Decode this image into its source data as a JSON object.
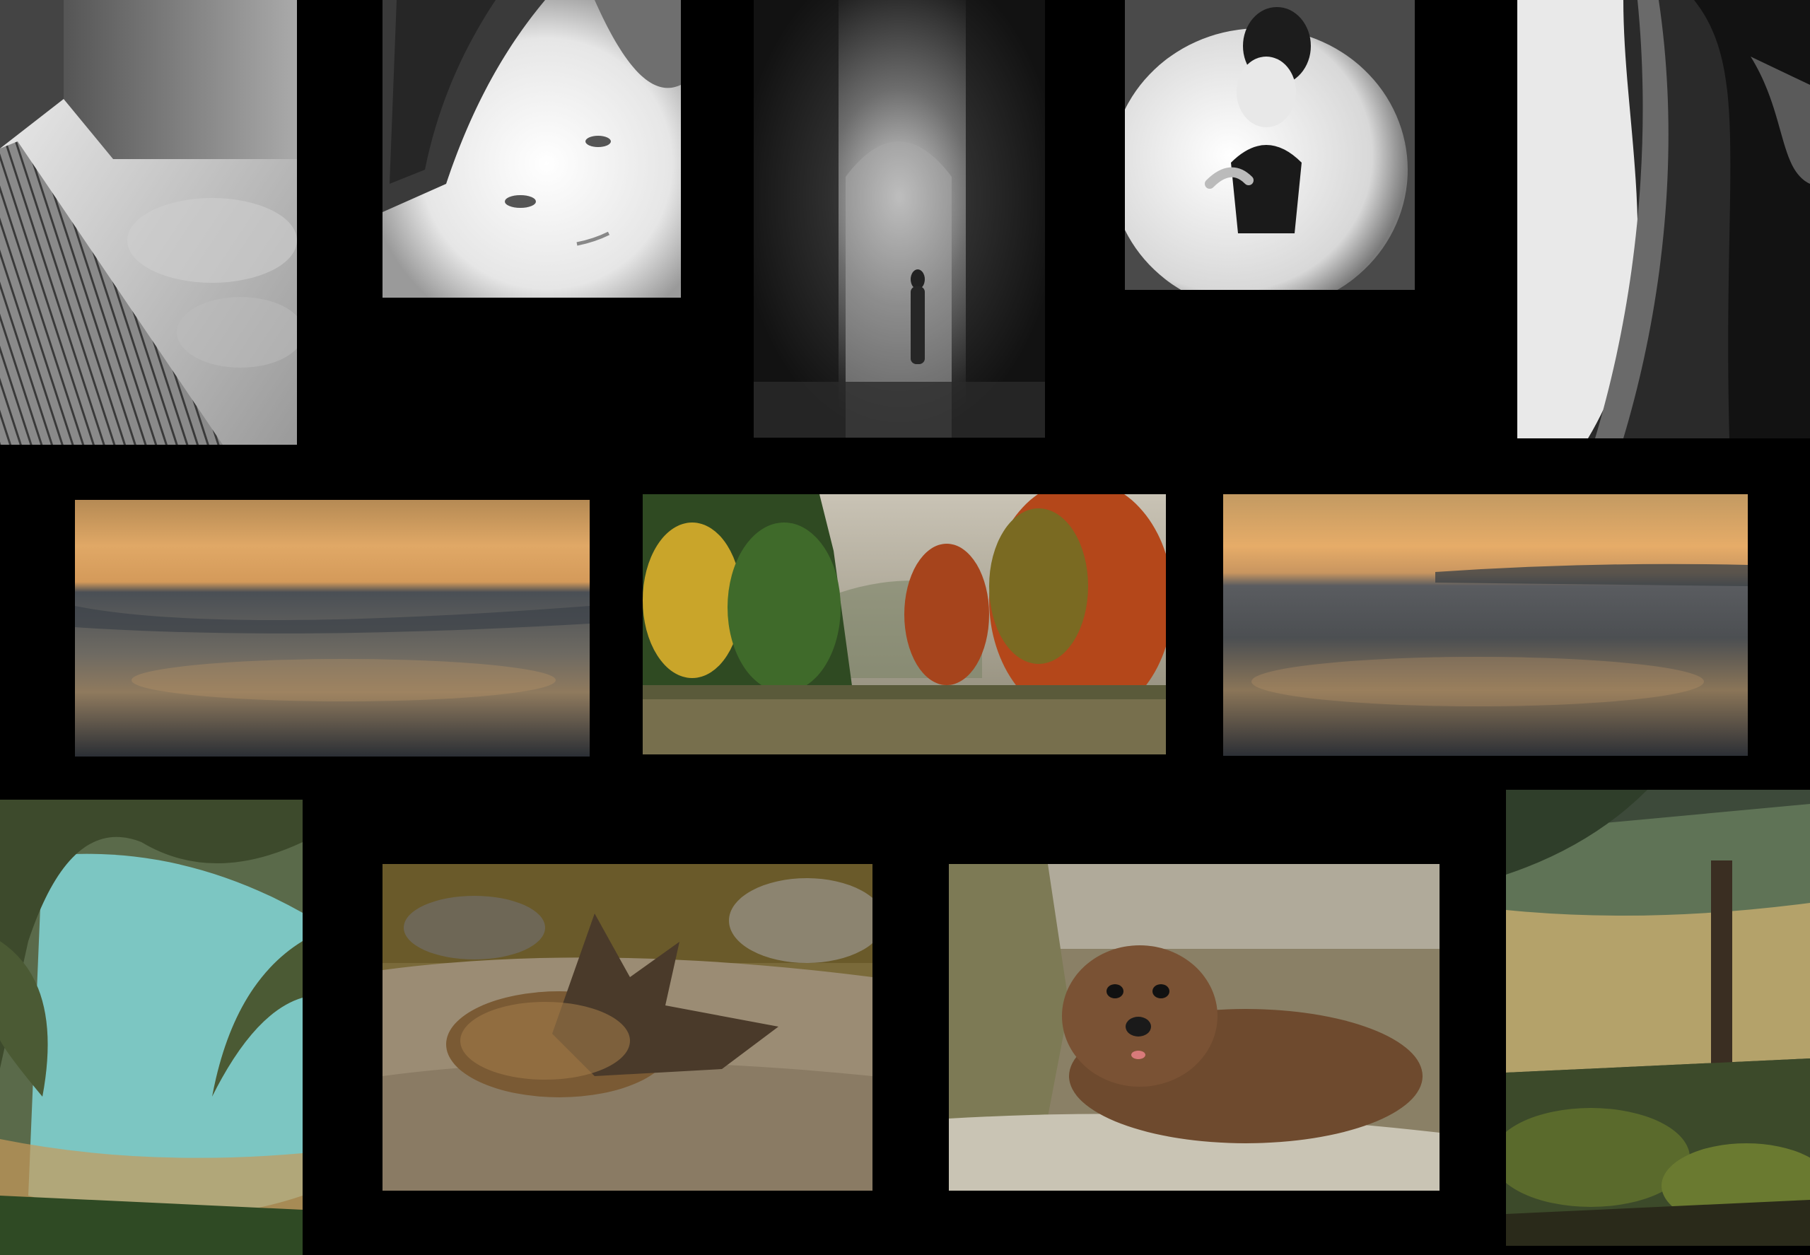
{
  "page": {
    "background": "#000000"
  },
  "gallery": {
    "photos": [
      {
        "name": "architecture-skyward-photo",
        "subject": "architecture",
        "tone": "monochrome"
      },
      {
        "name": "portrait-woman-looking-up-photo",
        "subject": "portrait",
        "tone": "monochrome"
      },
      {
        "name": "blurred-archway-figure-photo",
        "subject": "archway",
        "tone": "monochrome"
      },
      {
        "name": "ballerina-from-above-photo",
        "subject": "ballerina",
        "tone": "monochrome"
      },
      {
        "name": "abstract-figure-curves-photo",
        "subject": "abstract",
        "tone": "monochrome"
      },
      {
        "name": "beach-sunset-left-photo",
        "subject": "seascape",
        "tone": "color"
      },
      {
        "name": "autumn-trees-pond-photo",
        "subject": "landscape",
        "tone": "color"
      },
      {
        "name": "beach-sunset-right-photo",
        "subject": "seascape",
        "tone": "color"
      },
      {
        "name": "mossy-trees-lagoon-photo",
        "subject": "forest",
        "tone": "color"
      },
      {
        "name": "resting-duck-photo",
        "subject": "bird",
        "tone": "color"
      },
      {
        "name": "fur-seal-pup-photo",
        "subject": "seal",
        "tone": "color"
      },
      {
        "name": "forest-lake-view-photo",
        "subject": "forest",
        "tone": "color"
      }
    ]
  }
}
